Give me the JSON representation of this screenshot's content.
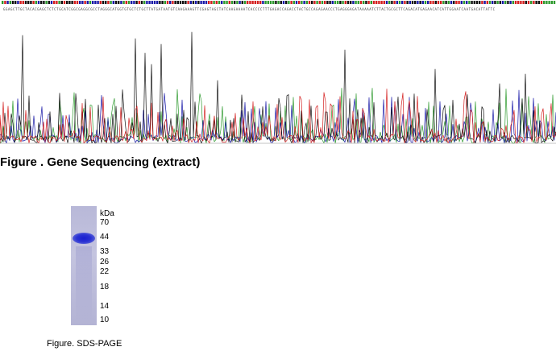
{
  "sequence": "GGAGCTTGCTACACGAGCTCTCTGCATCGGCGAGGCGCCTAGGGCATGGTGTGCTCTGCTTATGATAATGTCAAGAAAGTTCGAGTAGCTATCAAGAAAATCACCCCTTTGAGACCAGACCTACTGCCAGAGAACCCTGAGGGAGATAAAAATCTTACTGCGCTTCAGACATGAGAACATCATTGGAATCAATGACATTATTC",
  "figure1": {
    "caption": "Figure . Gene Sequencing (extract)"
  },
  "figure2": {
    "caption": "Figure. SDS-PAGE",
    "unit": "kDa",
    "markers": [
      {
        "label": "70",
        "kda": 70
      },
      {
        "label": "44",
        "kda": 44
      },
      {
        "label": "33",
        "kda": 33
      },
      {
        "label": "26",
        "kda": 26
      },
      {
        "label": "22",
        "kda": 22
      },
      {
        "label": "18",
        "kda": 18
      },
      {
        "label": "14",
        "kda": 14
      },
      {
        "label": "10",
        "kda": 10
      }
    ]
  },
  "trace_colors": {
    "A": "#2e9a2e",
    "C": "#1a1aa8",
    "G": "#111111",
    "T": "#d42020"
  }
}
